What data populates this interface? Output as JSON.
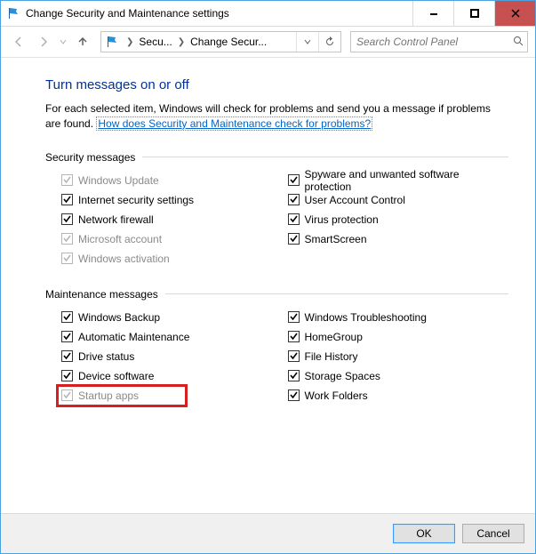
{
  "titlebar": {
    "title": "Change Security and Maintenance settings"
  },
  "nav": {
    "crumb1": "Secu...",
    "crumb2": "Change Secur..."
  },
  "search": {
    "placeholder": "Search Control Panel"
  },
  "page": {
    "title": "Turn messages on or off",
    "desc_pre": "For each selected item, Windows will check for problems and send you a message if problems are found. ",
    "desc_link": "How does Security and Maintenance check for problems?"
  },
  "sections": {
    "security": {
      "title": "Security messages",
      "left": [
        {
          "label": "Windows Update",
          "checked": true,
          "disabled": true
        },
        {
          "label": "Internet security settings",
          "checked": true,
          "disabled": false
        },
        {
          "label": "Network firewall",
          "checked": true,
          "disabled": false
        },
        {
          "label": "Microsoft account",
          "checked": true,
          "disabled": true
        },
        {
          "label": "Windows activation",
          "checked": true,
          "disabled": true
        }
      ],
      "right": [
        {
          "label": "Spyware and unwanted software protection",
          "checked": true,
          "disabled": false
        },
        {
          "label": "User Account Control",
          "checked": true,
          "disabled": false
        },
        {
          "label": "Virus protection",
          "checked": true,
          "disabled": false
        },
        {
          "label": "SmartScreen",
          "checked": true,
          "disabled": false
        }
      ]
    },
    "maintenance": {
      "title": "Maintenance messages",
      "left": [
        {
          "label": "Windows Backup",
          "checked": true,
          "disabled": false
        },
        {
          "label": "Automatic Maintenance",
          "checked": true,
          "disabled": false
        },
        {
          "label": "Drive status",
          "checked": true,
          "disabled": false
        },
        {
          "label": "Device software",
          "checked": true,
          "disabled": false
        },
        {
          "label": "Startup apps",
          "checked": true,
          "disabled": true,
          "highlight": true
        }
      ],
      "right": [
        {
          "label": "Windows Troubleshooting",
          "checked": true,
          "disabled": false
        },
        {
          "label": "HomeGroup",
          "checked": true,
          "disabled": false
        },
        {
          "label": "File History",
          "checked": true,
          "disabled": false
        },
        {
          "label": "Storage Spaces",
          "checked": true,
          "disabled": false
        },
        {
          "label": "Work Folders",
          "checked": true,
          "disabled": false
        }
      ]
    }
  },
  "footer": {
    "ok": "OK",
    "cancel": "Cancel"
  }
}
